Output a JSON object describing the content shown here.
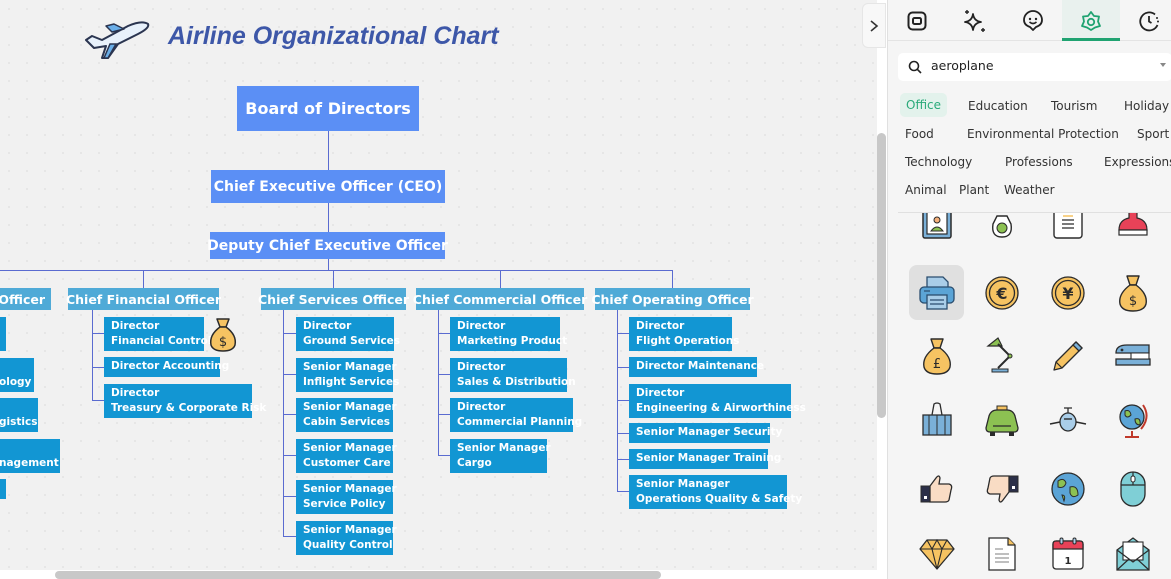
{
  "canvas": {
    "title": "Airline Organizational Chart",
    "title_icon": "airplane-icon",
    "colors": {
      "title": "#3d57a8",
      "top_node": "#5b8ff5",
      "chief_node": "#4faad7",
      "sub_node": "#1296d3",
      "connector": "#5a6bd0"
    },
    "org": {
      "board": "Board of Directors",
      "ceo": "Chief Executive Officer (CEO)",
      "deputy": "Deputy Chief Executive Officer",
      "partial_chief": "Officer",
      "partial_items": [
        "",
        "ology",
        "gistics",
        "nagement",
        ""
      ],
      "chiefs": [
        {
          "title": "Chief Financial Officer",
          "items": [
            {
              "line1": "Director",
              "line2": "Financial Control"
            },
            {
              "line1": "Director Accounting",
              "line2": ""
            },
            {
              "line1": "Director",
              "line2": "Treasury & Corporate Risk"
            }
          ],
          "attached_icon": "money-bag-dollar-icon"
        },
        {
          "title": "Chief Services Officer",
          "items": [
            {
              "line1": "Director",
              "line2": "Ground Services"
            },
            {
              "line1": "Senior Manager",
              "line2": "Inflight Services"
            },
            {
              "line1": "Senior Manager",
              "line2": "Cabin Services"
            },
            {
              "line1": "Senior Manager",
              "line2": "Customer Care"
            },
            {
              "line1": "Senior Manager",
              "line2": "Service Policy"
            },
            {
              "line1": "Senior Manager",
              "line2": "Quality Control"
            }
          ]
        },
        {
          "title": "Chief Commercial Officer",
          "items": [
            {
              "line1": "Director",
              "line2": "Marketing Product"
            },
            {
              "line1": "Director",
              "line2": "Sales & Distribution"
            },
            {
              "line1": "Director",
              "line2": "Commercial Planning"
            },
            {
              "line1": "Senior Manager",
              "line2": "Cargo"
            }
          ]
        },
        {
          "title": "Chief Operating Officer",
          "items": [
            {
              "line1": "Director",
              "line2": "Flight Operations"
            },
            {
              "line1": "Director Maintenance",
              "line2": ""
            },
            {
              "line1": "Director",
              "line2": "Engineering & Airworthiness"
            },
            {
              "line1": "Senior Manager Security",
              "line2": ""
            },
            {
              "line1": "Senior Manager Training",
              "line2": ""
            },
            {
              "line1": "Senior Manager",
              "line2": "Operations Quality & Safety"
            }
          ]
        }
      ]
    }
  },
  "panel": {
    "collapse_icon": "chevron-right-icon",
    "tabs": [
      {
        "name": "shape-icon"
      },
      {
        "name": "sparkle-icon"
      },
      {
        "name": "emoji-icon"
      },
      {
        "name": "flower-icon",
        "active": true
      },
      {
        "name": "history-icon"
      }
    ],
    "search": {
      "value": "aeroplane",
      "placeholder": "Search"
    },
    "categories": [
      {
        "label": "Office",
        "active": true
      },
      {
        "label": "Education"
      },
      {
        "label": "Tourism"
      },
      {
        "label": "Holiday"
      },
      {
        "label": "Food"
      },
      {
        "label": "Environmental Protection"
      },
      {
        "label": "Sport"
      },
      {
        "label": "Technology"
      },
      {
        "label": "Professions"
      },
      {
        "label": "Expressions"
      },
      {
        "label": "Animal"
      },
      {
        "label": "Plant"
      },
      {
        "label": "Weather"
      }
    ],
    "accent_color": "#1fa371",
    "icons": [
      "id-badge-icon",
      "ink-bottle-icon",
      "document-icon",
      "stamp-icon",
      "printer-icon",
      "euro-coin-icon",
      "yen-coin-icon",
      "money-bag-dollar-icon",
      "money-bag-pound-icon",
      "desk-lamp-icon",
      "pencil-icon",
      "stapler-icon",
      "binder-clip-icon",
      "taxi-icon",
      "airplane-icon",
      "globe-stand-icon",
      "thumbs-up-icon",
      "thumbs-down-icon",
      "earth-icon",
      "computer-mouse-icon",
      "diamond-icon",
      "paper-file-icon",
      "calendar-icon",
      "open-envelope-icon"
    ],
    "selected_icon": "printer-icon"
  }
}
